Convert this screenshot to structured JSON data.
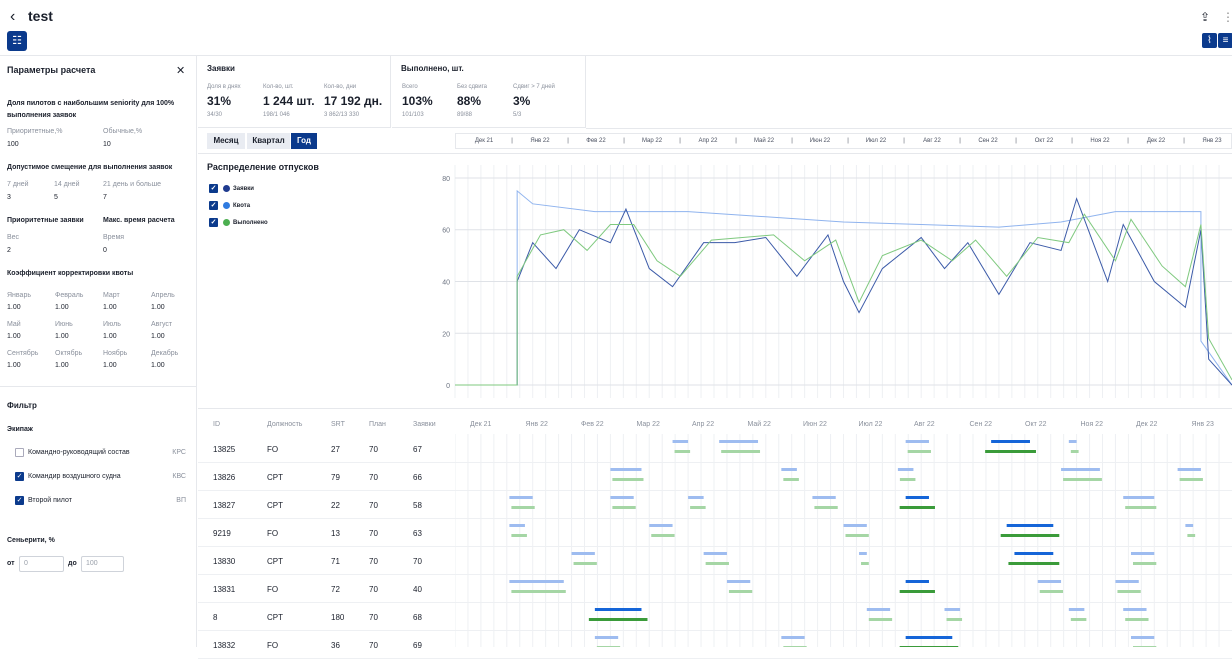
{
  "header": {
    "back": "‹",
    "title": "test",
    "share_icon": "⇪",
    "more_icon": "⋮"
  },
  "sidebar": {
    "title": "Параметры расчета",
    "close": "✕",
    "pilots_title": "Доля пилотов с наибольшим seniority для 100% выполнения заявок",
    "prio_label": "Приоритетные,%",
    "prio_value": "100",
    "norm_label": "Обычные,%",
    "norm_value": "10",
    "shift_title": "Допустимое смещение для выполнения заявок",
    "shift": [
      {
        "l": "7 дней",
        "v": "3"
      },
      {
        "l": "14 дней",
        "v": "5"
      },
      {
        "l": "21 день и больше",
        "v": "7"
      }
    ],
    "prio_req": "Приоритетные заявки",
    "max_time": "Макс. время расчета",
    "weight_l": "Вес",
    "weight_v": "2",
    "time_l": "Время",
    "time_v": "0",
    "coef_title": "Коэффициент корректировки квоты",
    "months": [
      {
        "l": "Январь",
        "v": "1.00"
      },
      {
        "l": "Февраль",
        "v": "1.00"
      },
      {
        "l": "Март",
        "v": "1.00"
      },
      {
        "l": "Апрель",
        "v": "1.00"
      },
      {
        "l": "Май",
        "v": "1.00"
      },
      {
        "l": "Июнь",
        "v": "1.00"
      },
      {
        "l": "Июль",
        "v": "1.00"
      },
      {
        "l": "Август",
        "v": "1.00"
      },
      {
        "l": "Сентябрь",
        "v": "1.00"
      },
      {
        "l": "Октябрь",
        "v": "1.00"
      },
      {
        "l": "Ноябрь",
        "v": "1.00"
      },
      {
        "l": "Декабрь",
        "v": "1.00"
      }
    ],
    "filter_title": "Фильтр",
    "crew_title": "Экипаж",
    "crew": [
      {
        "l": "Командно-руководящий состав",
        "c": "КРС",
        "on": false
      },
      {
        "l": "Командир воздушного судна",
        "c": "КВС",
        "on": true
      },
      {
        "l": "Второй пилот",
        "c": "ВП",
        "on": true
      }
    ],
    "seniority_title": "Сеньерити, %",
    "from": "от",
    "to": "до",
    "from_ph": "0",
    "to_ph": "100"
  },
  "kpi": {
    "requests": {
      "title": "Заявки",
      "items": [
        {
          "l": "Доля в днях",
          "v": "31%",
          "s": "34/30"
        },
        {
          "l": "Кол-во, шт.",
          "v": "1 244 шт.",
          "s": "198/1 046"
        },
        {
          "l": "Кол-во, дни",
          "v": "17 192 дн.",
          "s": "3 862/13 330"
        }
      ]
    },
    "done": {
      "title": "Выполнено, шт.",
      "items": [
        {
          "l": "Всего",
          "v": "103%",
          "s": "101/103"
        },
        {
          "l": "Без сдвига",
          "v": "88%",
          "s": "89/88"
        },
        {
          "l": "Сдвиг > 7 дней",
          "v": "3%",
          "s": "5/3"
        }
      ]
    }
  },
  "tabs": [
    "Месяц",
    "Квартал",
    "Год"
  ],
  "months": [
    "Дек 21",
    "Янв 22",
    "Фев 22",
    "Мар 22",
    "Апр 22",
    "Май 22",
    "Июн 22",
    "Июл 22",
    "Авг 22",
    "Сен 22",
    "Окт 22",
    "Ноя 22",
    "Дек 22",
    "Янв 23"
  ],
  "chart_title": "Распределение отпусков",
  "legend": [
    {
      "name": "Заявки",
      "color": "#1f3b8f"
    },
    {
      "name": "Квота",
      "color": "#2f7be0"
    },
    {
      "name": "Выполнено",
      "color": "#4caf50"
    }
  ],
  "chart_data": {
    "type": "line",
    "x_start": "2021-12",
    "x_end": "2023-01",
    "ylim": [
      -5,
      85
    ],
    "yticks": [
      0,
      20,
      40,
      60,
      80
    ],
    "series": [
      {
        "name": "Квота",
        "color": "#8fb3ee",
        "points": [
          [
            0,
            0
          ],
          [
            0.08,
            0
          ],
          [
            0.08,
            75
          ],
          [
            0.1,
            70
          ],
          [
            0.18,
            67
          ],
          [
            0.3,
            67
          ],
          [
            0.4,
            65
          ],
          [
            0.5,
            63
          ],
          [
            0.6,
            62
          ],
          [
            0.7,
            61
          ],
          [
            0.78,
            63
          ],
          [
            0.85,
            67
          ],
          [
            0.95,
            67
          ],
          [
            0.96,
            67
          ],
          [
            0.96,
            17
          ],
          [
            1,
            0
          ]
        ]
      },
      {
        "name": "Заявки",
        "color": "#3b5aa8",
        "points": [
          [
            0,
            0
          ],
          [
            0.08,
            0
          ],
          [
            0.08,
            40
          ],
          [
            0.1,
            55
          ],
          [
            0.13,
            45
          ],
          [
            0.16,
            60
          ],
          [
            0.2,
            55
          ],
          [
            0.22,
            68
          ],
          [
            0.25,
            45
          ],
          [
            0.28,
            38
          ],
          [
            0.32,
            55
          ],
          [
            0.36,
            55
          ],
          [
            0.4,
            57
          ],
          [
            0.44,
            42
          ],
          [
            0.48,
            58
          ],
          [
            0.5,
            40
          ],
          [
            0.52,
            28
          ],
          [
            0.55,
            45
          ],
          [
            0.6,
            57
          ],
          [
            0.63,
            45
          ],
          [
            0.66,
            55
          ],
          [
            0.7,
            35
          ],
          [
            0.74,
            55
          ],
          [
            0.78,
            52
          ],
          [
            0.8,
            72
          ],
          [
            0.84,
            40
          ],
          [
            0.86,
            62
          ],
          [
            0.9,
            40
          ],
          [
            0.94,
            30
          ],
          [
            0.96,
            60
          ],
          [
            0.97,
            10
          ],
          [
            1,
            0
          ]
        ]
      },
      {
        "name": "Выполнено",
        "color": "#7fc97f",
        "points": [
          [
            0,
            0
          ],
          [
            0.08,
            0
          ],
          [
            0.08,
            42
          ],
          [
            0.11,
            58
          ],
          [
            0.14,
            60
          ],
          [
            0.17,
            52
          ],
          [
            0.2,
            62
          ],
          [
            0.23,
            62
          ],
          [
            0.26,
            48
          ],
          [
            0.29,
            42
          ],
          [
            0.33,
            56
          ],
          [
            0.37,
            57
          ],
          [
            0.41,
            58
          ],
          [
            0.45,
            48
          ],
          [
            0.49,
            56
          ],
          [
            0.52,
            32
          ],
          [
            0.55,
            50
          ],
          [
            0.6,
            56
          ],
          [
            0.64,
            48
          ],
          [
            0.67,
            56
          ],
          [
            0.71,
            42
          ],
          [
            0.75,
            57
          ],
          [
            0.79,
            55
          ],
          [
            0.81,
            66
          ],
          [
            0.85,
            48
          ],
          [
            0.87,
            64
          ],
          [
            0.91,
            46
          ],
          [
            0.94,
            38
          ],
          [
            0.96,
            62
          ],
          [
            0.97,
            18
          ],
          [
            1,
            2
          ]
        ]
      }
    ]
  },
  "table": {
    "headers": [
      "ID",
      "Должность",
      "SRT",
      "План",
      "Заявки"
    ],
    "rows": [
      [
        "13825",
        "FO",
        "27",
        "70",
        "67"
      ],
      [
        "13826",
        "CPT",
        "79",
        "70",
        "66"
      ],
      [
        "13827",
        "CPT",
        "22",
        "70",
        "58"
      ],
      [
        "9219",
        "FO",
        "13",
        "70",
        "63"
      ],
      [
        "13830",
        "CPT",
        "71",
        "70",
        "70"
      ],
      [
        "13831",
        "FO",
        "72",
        "70",
        "40"
      ],
      [
        "8",
        "CPT",
        "180",
        "70",
        "68"
      ],
      [
        "13832",
        "FO",
        "36",
        "70",
        "69"
      ]
    ]
  },
  "gantt": [
    [
      [
        0.28,
        0.3,
        0
      ],
      [
        0.34,
        0.39,
        0
      ],
      [
        0.58,
        0.61,
        0
      ],
      [
        0.69,
        0.74,
        2
      ],
      [
        0.79,
        0.8,
        0
      ]
    ],
    [
      [
        0.2,
        0.24,
        0
      ],
      [
        0.42,
        0.44,
        0
      ],
      [
        0.57,
        0.59,
        0
      ],
      [
        0.78,
        0.83,
        0
      ],
      [
        0.93,
        0.96,
        0
      ]
    ],
    [
      [
        0.07,
        0.1,
        0
      ],
      [
        0.2,
        0.23,
        0
      ],
      [
        0.3,
        0.32,
        0
      ],
      [
        0.46,
        0.49,
        0
      ],
      [
        0.58,
        0.61,
        2
      ],
      [
        0.86,
        0.9,
        0
      ]
    ],
    [
      [
        0.07,
        0.09,
        0
      ],
      [
        0.25,
        0.28,
        0
      ],
      [
        0.5,
        0.53,
        0
      ],
      [
        0.71,
        0.77,
        2
      ],
      [
        0.94,
        0.95,
        0
      ]
    ],
    [
      [
        0.15,
        0.18,
        0
      ],
      [
        0.32,
        0.35,
        0
      ],
      [
        0.52,
        0.53,
        0
      ],
      [
        0.72,
        0.77,
        2
      ],
      [
        0.87,
        0.9,
        0
      ]
    ],
    [
      [
        0.07,
        0.14,
        0
      ],
      [
        0.35,
        0.38,
        0
      ],
      [
        0.58,
        0.61,
        2
      ],
      [
        0.75,
        0.78,
        0
      ],
      [
        0.85,
        0.88,
        0
      ]
    ],
    [
      [
        0.18,
        0.24,
        2
      ],
      [
        0.53,
        0.56,
        0
      ],
      [
        0.63,
        0.65,
        0
      ],
      [
        0.79,
        0.81,
        0
      ],
      [
        0.86,
        0.89,
        0
      ]
    ],
    [
      [
        0.18,
        0.21,
        0
      ],
      [
        0.42,
        0.45,
        0
      ],
      [
        0.58,
        0.64,
        2
      ],
      [
        0.87,
        0.9,
        0
      ]
    ]
  ]
}
